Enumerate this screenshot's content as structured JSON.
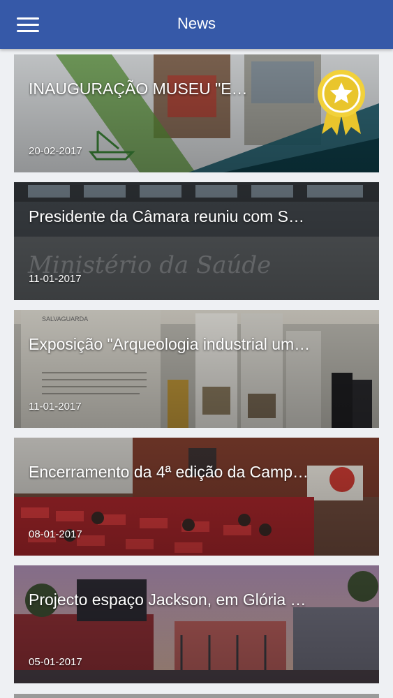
{
  "header": {
    "title": "News",
    "menu_icon": "hamburger-menu-icon",
    "color": "#3659a8"
  },
  "news": [
    {
      "title": "INAUGURAÇÃO MUSEU \"E…",
      "date": "20-02-2017",
      "featured": true,
      "badge_icon": "award-ribbon-icon",
      "badge_color": "#f2d13a"
    },
    {
      "title": "Presidente da Câmara reuniu com S…",
      "date": "11-01-2017"
    },
    {
      "title": "Exposição \"Arqueologia industrial um…",
      "date": "11-01-2017"
    },
    {
      "title": "Encerramento da 4ª edição da Camp…",
      "date": "08-01-2017"
    },
    {
      "title": "Projecto espaço Jackson, em Glória …",
      "date": "05-01-2017"
    }
  ],
  "photo_text": {
    "building_sign": "Ministério da Saúde",
    "exhibition_panel": "SALVAGUARDA"
  }
}
